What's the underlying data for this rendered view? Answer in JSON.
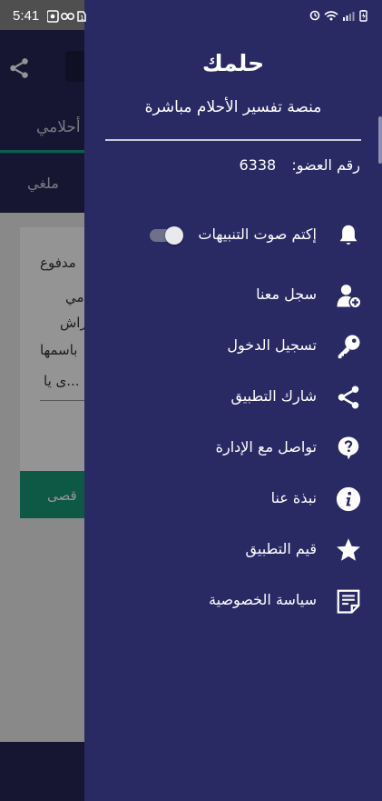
{
  "status_bar": {
    "time": "5:41"
  },
  "background": {
    "tab_1": "أحلامي",
    "tab_2": "ملغي",
    "card_lines": [
      "مدفوع",
      "مي",
      "راش",
      "باسمها",
      "ى يا..."
    ],
    "card_button": "قصى"
  },
  "drawer": {
    "app_name": "حلمك",
    "tagline": "منصة تفسير الأحلام مباشرة",
    "member_label": "رقم العضو:",
    "member_id": "6338",
    "notifications": {
      "label": "إكتم صوت التنبيهات",
      "icon": "bell-icon",
      "enabled": true
    },
    "items": [
      {
        "label": "سجل معنا",
        "icon": "user-add-icon"
      },
      {
        "label": "تسجيل الدخول",
        "icon": "key-icon"
      },
      {
        "label": "شارك التطبيق",
        "icon": "share-icon"
      },
      {
        "label": "تواصل مع الإدارة",
        "icon": "help-chat-icon"
      },
      {
        "label": "نبذة عنا",
        "icon": "info-icon"
      },
      {
        "label": "قيم التطبيق",
        "icon": "star-icon"
      },
      {
        "label": "سياسة الخصوصية",
        "icon": "document-icon"
      }
    ]
  },
  "colors": {
    "drawer_bg": "#292a64",
    "toolbar_bg": "#262757",
    "accent": "#189a78"
  }
}
